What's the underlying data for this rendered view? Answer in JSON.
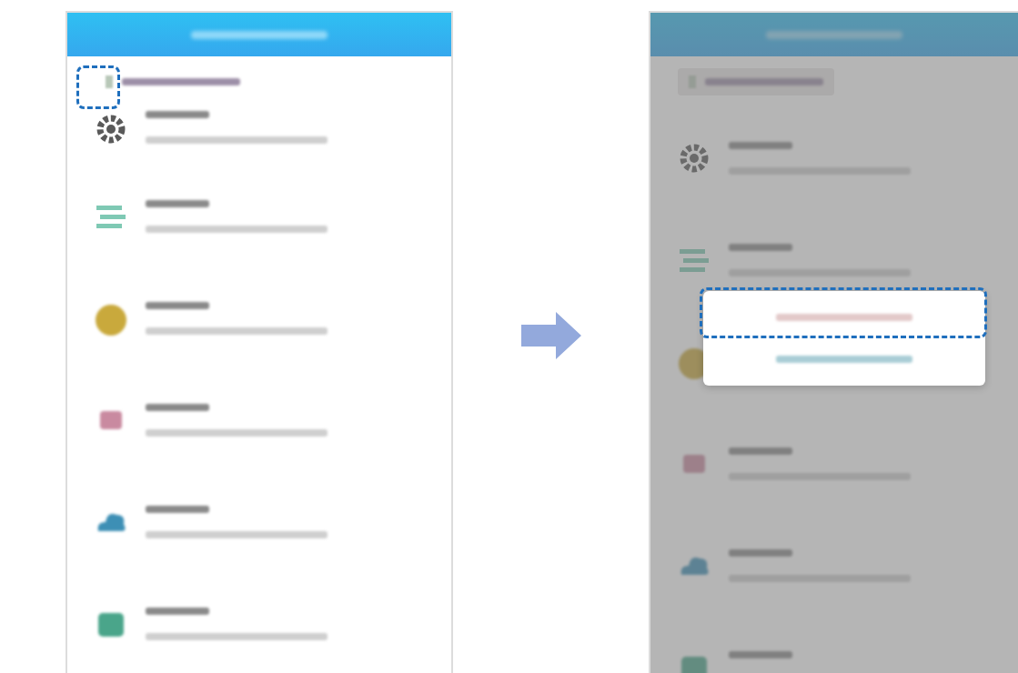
{
  "steps": [
    {
      "dimmed": false,
      "back_highlighted": true,
      "items": [
        {
          "kind": "gear"
        },
        {
          "kind": "bars"
        },
        {
          "kind": "circle"
        },
        {
          "kind": "square"
        },
        {
          "kind": "cloud"
        },
        {
          "kind": "folder"
        }
      ]
    },
    {
      "dimmed": true,
      "back_highlighted": false,
      "items": [
        {
          "kind": "gear"
        },
        {
          "kind": "bars"
        },
        {
          "kind": "circle"
        },
        {
          "kind": "square"
        },
        {
          "kind": "cloud"
        },
        {
          "kind": "folder"
        }
      ],
      "menu": {
        "options": [
          {
            "highlighted": true
          },
          {
            "highlighted": false
          }
        ]
      }
    }
  ],
  "arrow": {
    "color": "#93a9dc"
  }
}
